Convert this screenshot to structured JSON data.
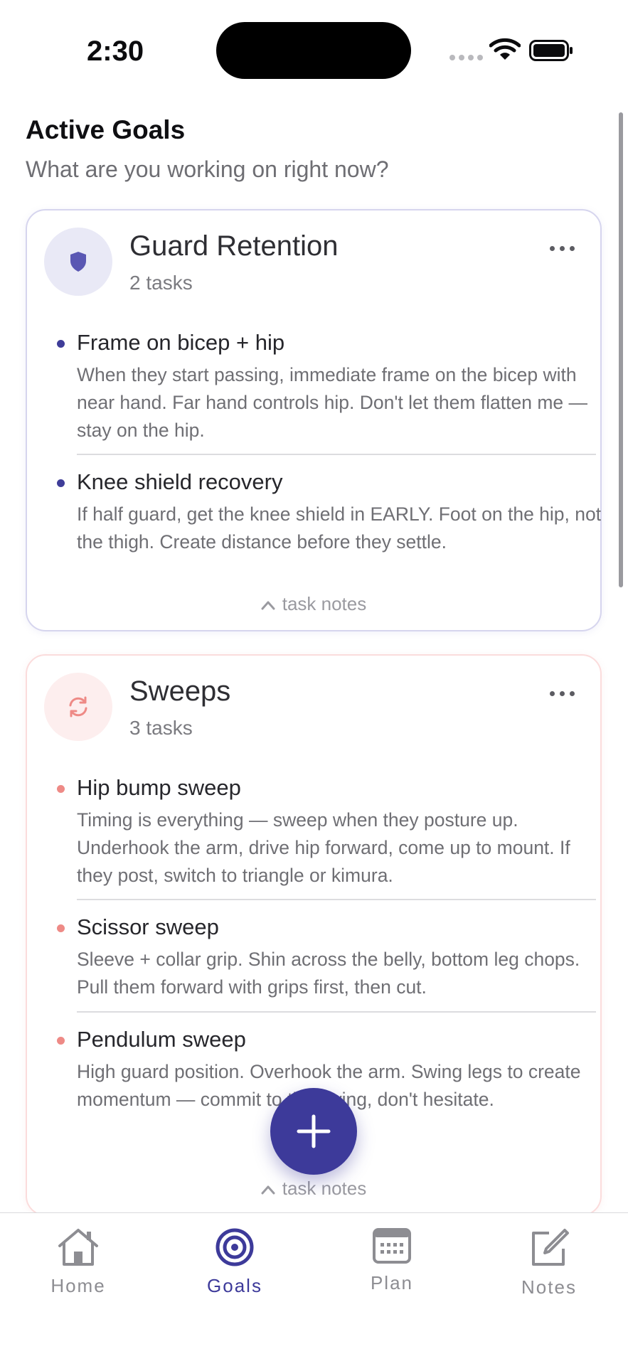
{
  "status_bar": {
    "time": "2:30"
  },
  "header": {
    "title": "Active Goals",
    "subtitle": "What are you working on right now?"
  },
  "goals": [
    {
      "title": "Guard Retention",
      "count": "2 tasks",
      "icon": "shield-icon",
      "accent": "#3f3d99",
      "tasks": [
        {
          "title": "Frame on bicep + hip",
          "desc": "When they start passing, immediate frame on the bicep with near hand. Far hand controls hip. Don't let them flatten me — stay on the hip."
        },
        {
          "title": "Knee shield recovery",
          "desc": "If half guard, get the knee shield in EARLY. Foot on the hip, not the thigh. Create distance before they settle."
        }
      ],
      "notes_label": "task notes"
    },
    {
      "title": "Sweeps",
      "count": "3 tasks",
      "icon": "sweep-arrows-icon",
      "accent": "#ee8a86",
      "tasks": [
        {
          "title": "Hip bump sweep",
          "desc": "Timing is everything — sweep when they posture up. Underhook the arm, drive hip forward, come up to mount. If they post, switch to triangle or kimura."
        },
        {
          "title": "Scissor sweep",
          "desc": "Sleeve + collar grip. Shin across the belly, bottom leg chops. Pull them forward with grips first, then cut."
        },
        {
          "title": "Pendulum sweep",
          "desc": "High guard position. Overhook the arm. Swing legs to create momentum — commit to the swing, don't hesitate."
        }
      ],
      "notes_label": "task notes"
    }
  ],
  "tabs": [
    {
      "label": "Home",
      "icon": "home-icon"
    },
    {
      "label": "Goals",
      "icon": "target-icon",
      "active": true
    },
    {
      "label": "Plan",
      "icon": "calendar-icon"
    },
    {
      "label": "Notes",
      "icon": "compose-icon"
    }
  ],
  "colors": {
    "primary": "#3d3a9a",
    "sweeps_accent": "#ee8a86"
  }
}
